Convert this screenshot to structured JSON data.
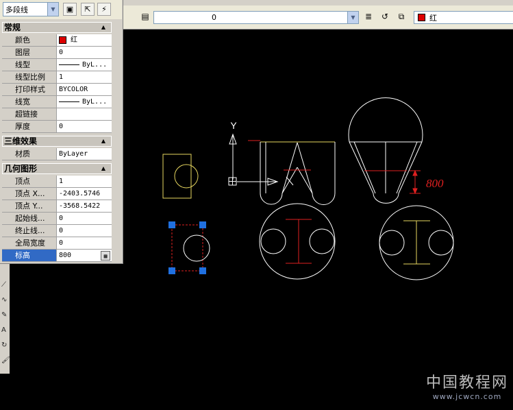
{
  "toolbar": {
    "layer_value": "0",
    "color_value": "红",
    "color_swatch": "#cc0000"
  },
  "palette": {
    "selection_type": "多段线",
    "sections": {
      "general": "常规",
      "effects3d": "三维效果",
      "geometry": "几何图形"
    },
    "general_rows": [
      {
        "label": "颜色",
        "value": "红"
      },
      {
        "label": "图层",
        "value": "0"
      },
      {
        "label": "线型",
        "value": "ByL..."
      },
      {
        "label": "线型比例",
        "value": "1"
      },
      {
        "label": "打印样式",
        "value": "BYCOLOR"
      },
      {
        "label": "线宽",
        "value": "ByL..."
      },
      {
        "label": "超链接",
        "value": ""
      },
      {
        "label": "厚度",
        "value": "0"
      }
    ],
    "effects_rows": [
      {
        "label": "材质",
        "value": "ByLayer"
      }
    ],
    "geometry_rows": [
      {
        "label": "顶点",
        "value": "1"
      },
      {
        "label": "顶点 X...",
        "value": "-2403.5746"
      },
      {
        "label": "顶点 Y...",
        "value": "-3568.5422"
      },
      {
        "label": "起始线...",
        "value": "0"
      },
      {
        "label": "终止线...",
        "value": "0"
      },
      {
        "label": "全局宽度",
        "value": "0"
      },
      {
        "label": "标高",
        "value": "800"
      }
    ]
  },
  "drawing": {
    "ucs_y_label": "Y",
    "dimension_text": "800",
    "colors": {
      "white": "#ffffff",
      "red": "#e02020",
      "yellow": "#e8d860",
      "grip": "#2070e0"
    }
  },
  "watermark": {
    "title": "中国教程网",
    "url": "www.jcwcn.com"
  }
}
